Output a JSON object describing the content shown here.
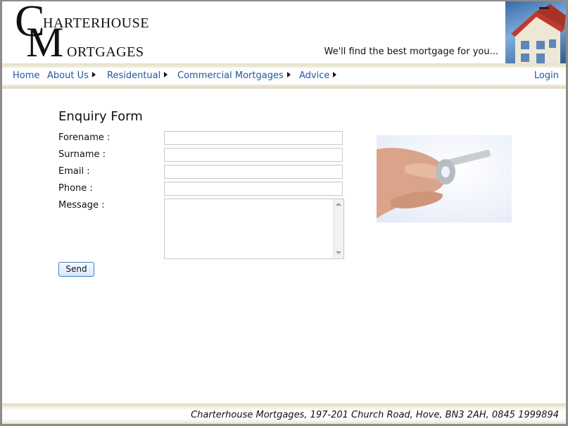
{
  "header": {
    "logo": {
      "letter_c": "C",
      "letter_m": "M",
      "line1": "HARTERHOUSE",
      "line2": "ORTGAGES"
    },
    "tagline": "We'll find the best mortgage for you...",
    "image_icon": "house-model-icon"
  },
  "nav": {
    "items": [
      {
        "label": "Home",
        "has_submenu": false
      },
      {
        "label": "About Us",
        "has_submenu": true
      },
      {
        "label": "Residentual",
        "has_submenu": true
      },
      {
        "label": "Commercial Mortgages",
        "has_submenu": true
      },
      {
        "label": "Advice",
        "has_submenu": true
      }
    ],
    "login": "Login"
  },
  "form": {
    "title": "Enquiry Form",
    "fields": {
      "forename": {
        "label": "Forename :",
        "value": ""
      },
      "surname": {
        "label": "Surname :",
        "value": ""
      },
      "email": {
        "label": "Email :",
        "value": ""
      },
      "phone": {
        "label": "Phone :",
        "value": ""
      },
      "message": {
        "label": "Message :",
        "value": ""
      }
    },
    "send_label": "Send"
  },
  "side_image_icon": "hand-holding-keys-icon",
  "footer": {
    "text": "Charterhouse Mortgages, 197-201 Church Road, Hove, BN3 2AH, 0845 1999894"
  },
  "colors": {
    "link": "#1f57a3",
    "band": "#e4dfc7",
    "button_border": "#3a7fc0"
  }
}
